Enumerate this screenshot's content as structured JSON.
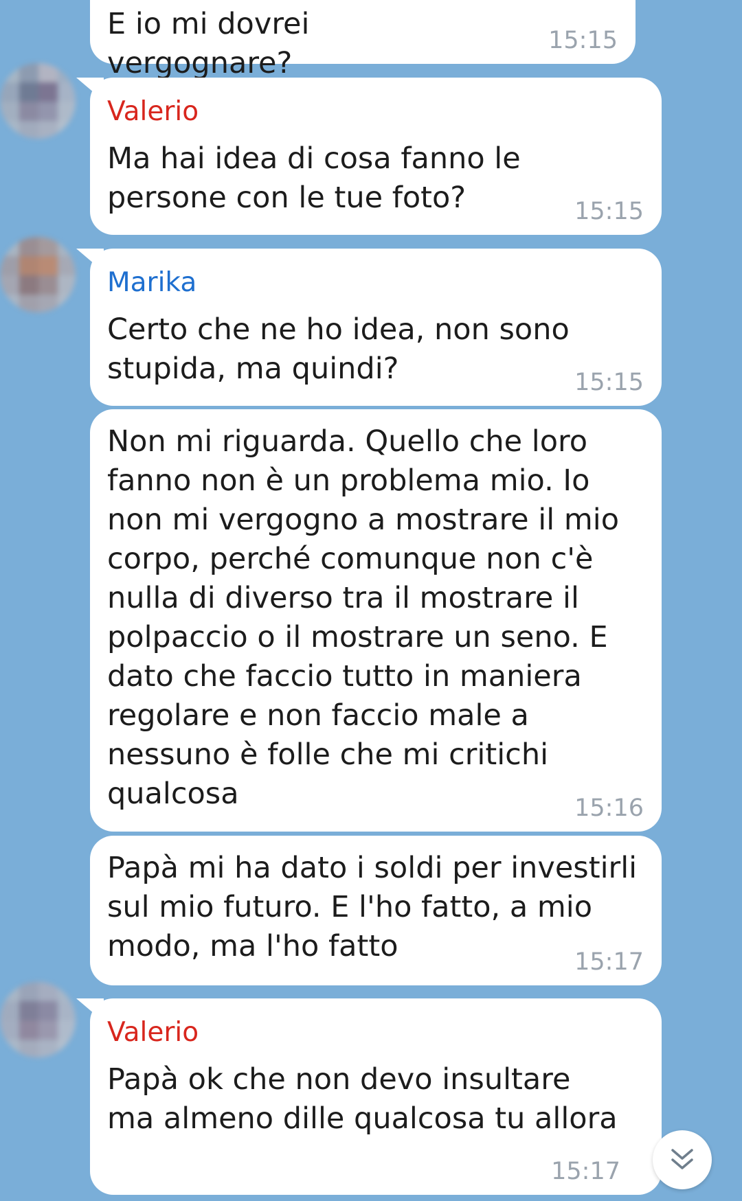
{
  "chat": {
    "messages": [
      {
        "text": "E io mi dovrei vergognare?",
        "time": "15:15"
      },
      {
        "sender": "Valerio",
        "text": "Ma hai idea di cosa fanno le\npersone con le tue foto?",
        "time": "15:15"
      },
      {
        "sender": "Marika",
        "text": "Certo che ne ho idea, non sono\nstupida, ma quindi?",
        "time": "15:15"
      },
      {
        "text": "Non mi riguarda. Quello che loro\nfanno non è un problema mio. Io\nnon mi vergogno a mostrare il mio\ncorpo, perché comunque non c'è\nnulla di diverso tra il mostrare il\npolpaccio o il mostrare un seno. E\ndato che faccio tutto in maniera\nregolare e non faccio male a\nnessuno è folle che mi critichi\nqualcosa",
        "time": "15:16"
      },
      {
        "text": "Papà mi ha dato i soldi per investirli\nsul mio futuro. E l'ho fatto, a mio\nmodo, ma l'ho fatto",
        "time": "15:17"
      },
      {
        "sender": "Valerio",
        "text": "Papà ok che non devo insultare\nma almeno dille qualcosa tu allora",
        "time": "15:17"
      }
    ]
  },
  "icons": {
    "avatar": "blurred-avatar-icon",
    "scroll_down": "double-chevron-down-icon"
  },
  "colors": {
    "background": "#7aaed8",
    "bubble": "#ffffff",
    "sender_valerio": "#d8261d",
    "sender_marika": "#1e6fcf",
    "timestamp": "#9aa3ad"
  }
}
